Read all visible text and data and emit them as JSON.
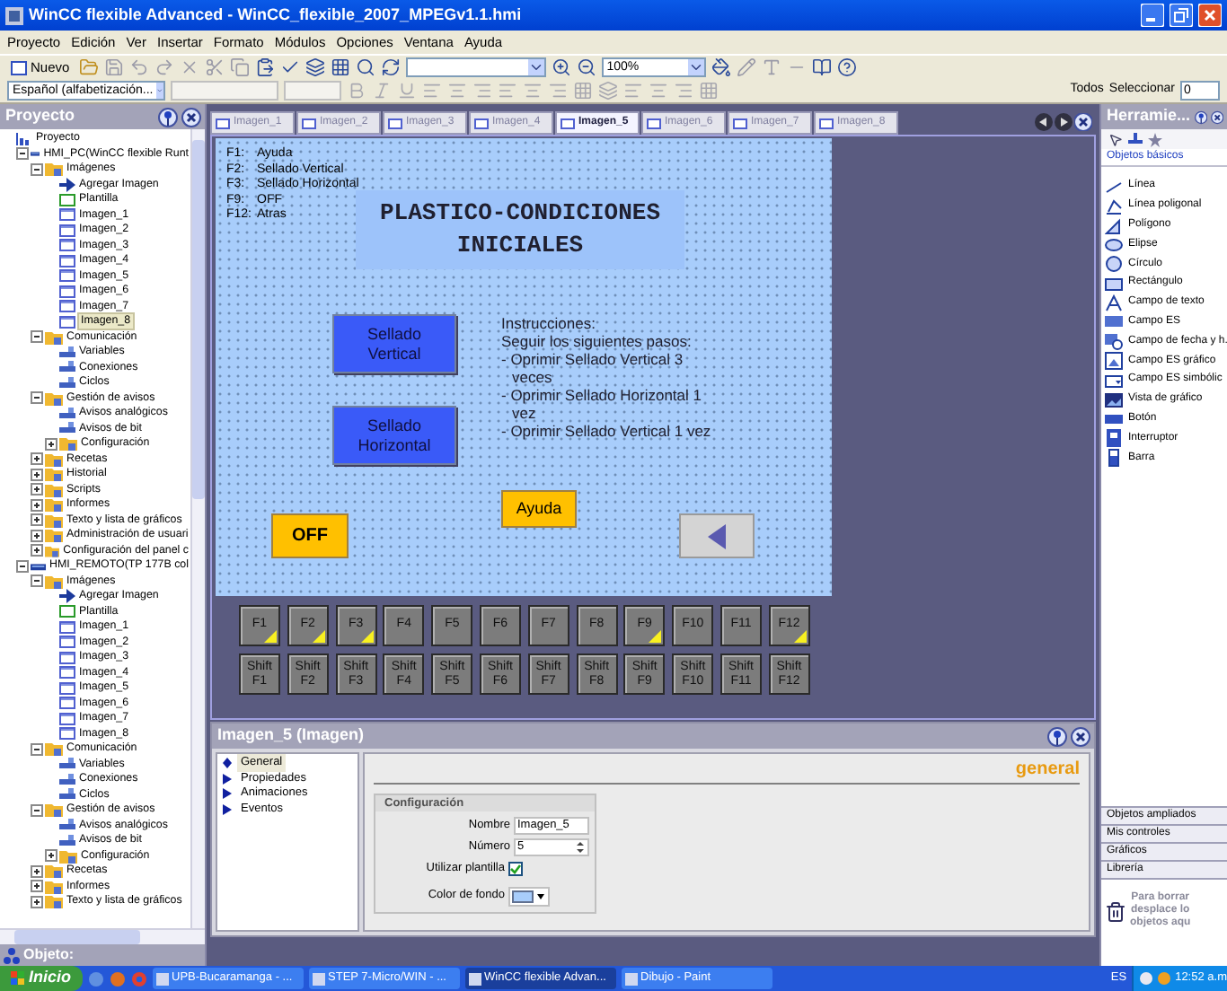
{
  "window": {
    "title": "WinCC flexible Advanced - WinCC_flexible_2007_MPEGv1.1.hmi"
  },
  "menu": [
    "Proyecto",
    "Edición",
    "Ver",
    "Insertar",
    "Formato",
    "Módulos",
    "Opciones",
    "Ventana",
    "Ayuda"
  ],
  "toolbar": {
    "new_button": "Nuevo",
    "zoom": "100%",
    "language": "Español (alfabetización...",
    "all_label": "Todos",
    "select_label": "Seleccionar",
    "spin_value": "0"
  },
  "project_panel": {
    "title": "Proyecto",
    "tree": [
      {
        "label": "Proyecto",
        "kind": "root",
        "selected": false,
        "children": [
          {
            "label": "HMI_PC(WinCC flexible Runt",
            "kind": "device",
            "selected": false,
            "expanded": true,
            "children": [
              {
                "label": "Imágenes",
                "kind": "folder",
                "selected": false,
                "expanded": true,
                "children": [
                  {
                    "label": "Agregar Imagen",
                    "kind": "add",
                    "selected": false
                  },
                  {
                    "label": "Plantilla",
                    "kind": "template",
                    "selected": false
                  },
                  {
                    "label": "Imagen_1",
                    "kind": "screen",
                    "selected": false
                  },
                  {
                    "label": "Imagen_2",
                    "kind": "screen",
                    "selected": false
                  },
                  {
                    "label": "Imagen_3",
                    "kind": "screen",
                    "selected": false
                  },
                  {
                    "label": "Imagen_4",
                    "kind": "screen",
                    "selected": false
                  },
                  {
                    "label": "Imagen_5",
                    "kind": "screen",
                    "selected": false
                  },
                  {
                    "label": "Imagen_6",
                    "kind": "screen",
                    "selected": false
                  },
                  {
                    "label": "Imagen_7",
                    "kind": "screen",
                    "selected": false
                  },
                  {
                    "label": "Imagen_8",
                    "kind": "screen",
                    "selected": true
                  }
                ]
              },
              {
                "label": "Comunicación",
                "kind": "folder",
                "selected": false,
                "expanded": true,
                "children": [
                  {
                    "label": "Variables",
                    "kind": "leaf",
                    "selected": false
                  },
                  {
                    "label": "Conexiones",
                    "kind": "leaf",
                    "selected": false
                  },
                  {
                    "label": "Ciclos",
                    "kind": "leaf",
                    "selected": false
                  }
                ]
              },
              {
                "label": "Gestión de avisos",
                "kind": "folder",
                "selected": false,
                "expanded": true,
                "children": [
                  {
                    "label": "Avisos analógicos",
                    "kind": "leaf",
                    "selected": false
                  },
                  {
                    "label": "Avisos de bit",
                    "kind": "leaf",
                    "selected": false
                  },
                  {
                    "label": "Configuración",
                    "kind": "folder",
                    "selected": false,
                    "expanded": false
                  }
                ]
              },
              {
                "label": "Recetas",
                "kind": "folder",
                "selected": false,
                "expanded": false
              },
              {
                "label": "Historial",
                "kind": "folder",
                "selected": false,
                "expanded": false
              },
              {
                "label": "Scripts",
                "kind": "folder",
                "selected": false,
                "expanded": false
              },
              {
                "label": "Informes",
                "kind": "folder",
                "selected": false,
                "expanded": false
              },
              {
                "label": "Texto y lista de gráficos",
                "kind": "folder",
                "selected": false,
                "expanded": false
              },
              {
                "label": "Administración de usuari",
                "kind": "folder",
                "selected": false,
                "expanded": false
              },
              {
                "label": "Configuración del panel c",
                "kind": "folder",
                "selected": false,
                "expanded": false
              }
            ]
          },
          {
            "label": "HMI_REMOTO(TP 177B col",
            "kind": "device",
            "selected": false,
            "expanded": true,
            "children": [
              {
                "label": "Imágenes",
                "kind": "folder",
                "selected": false,
                "expanded": true,
                "children": [
                  {
                    "label": "Agregar Imagen",
                    "kind": "add",
                    "selected": false
                  },
                  {
                    "label": "Plantilla",
                    "kind": "template",
                    "selected": false
                  },
                  {
                    "label": "Imagen_1",
                    "kind": "screen",
                    "selected": false
                  },
                  {
                    "label": "Imagen_2",
                    "kind": "screen",
                    "selected": false
                  },
                  {
                    "label": "Imagen_3",
                    "kind": "screen",
                    "selected": false
                  },
                  {
                    "label": "Imagen_4",
                    "kind": "screen",
                    "selected": false
                  },
                  {
                    "label": "Imagen_5",
                    "kind": "screen",
                    "selected": false
                  },
                  {
                    "label": "Imagen_6",
                    "kind": "screen",
                    "selected": false
                  },
                  {
                    "label": "Imagen_7",
                    "kind": "screen",
                    "selected": false
                  },
                  {
                    "label": "Imagen_8",
                    "kind": "screen",
                    "selected": false
                  }
                ]
              },
              {
                "label": "Comunicación",
                "kind": "folder",
                "selected": false,
                "expanded": true,
                "children": [
                  {
                    "label": "Variables",
                    "kind": "leaf",
                    "selected": false
                  },
                  {
                    "label": "Conexiones",
                    "kind": "leaf",
                    "selected": false
                  },
                  {
                    "label": "Ciclos",
                    "kind": "leaf",
                    "selected": false
                  }
                ]
              },
              {
                "label": "Gestión de avisos",
                "kind": "folder",
                "selected": false,
                "expanded": true,
                "children": [
                  {
                    "label": "Avisos analógicos",
                    "kind": "leaf",
                    "selected": false
                  },
                  {
                    "label": "Avisos de bit",
                    "kind": "leaf",
                    "selected": false
                  },
                  {
                    "label": "Configuración",
                    "kind": "folder",
                    "selected": false,
                    "expanded": false
                  }
                ]
              },
              {
                "label": "Recetas",
                "kind": "folder",
                "selected": false,
                "expanded": false
              },
              {
                "label": "Informes",
                "kind": "folder",
                "selected": false,
                "expanded": false
              },
              {
                "label": "Texto y lista de gráficos",
                "kind": "folder",
                "selected": false,
                "expanded": false
              }
            ]
          }
        ]
      }
    ]
  },
  "editor": {
    "tabs": [
      {
        "label": "Imagen_1",
        "selected": false
      },
      {
        "label": "Imagen_2",
        "selected": false
      },
      {
        "label": "Imagen_3",
        "selected": false
      },
      {
        "label": "Imagen_4",
        "selected": false
      },
      {
        "label": "Imagen_5",
        "selected": true
      },
      {
        "label": "Imagen_6",
        "selected": false
      },
      {
        "label": "Imagen_7",
        "selected": false
      },
      {
        "label": "Imagen_8",
        "selected": false
      }
    ],
    "screen": {
      "legend": [
        {
          "key": "F1:",
          "label": "Ayuda"
        },
        {
          "key": "F2:",
          "label": "Sellado Vertical"
        },
        {
          "key": "F3:",
          "label": "Sellado Horizontal"
        },
        {
          "key": "F9:",
          "label": "OFF"
        },
        {
          "key": "F12:",
          "label": "Atras"
        }
      ],
      "title": "PLASTICO-CONDICIONES INICIALES",
      "buttons": [
        {
          "kind": "action",
          "label": "Sellado Vertical"
        },
        {
          "kind": "action",
          "label": "Sellado Horizontal"
        },
        {
          "kind": "help",
          "label": "Ayuda"
        },
        {
          "kind": "off",
          "label": "OFF"
        },
        {
          "kind": "back"
        }
      ],
      "instructions": {
        "heading": "Instrucciones:",
        "intro": "Seguir los siguientes pasos:",
        "steps": [
          "- Oprimir Sellado Vertical 3 veces",
          "- Oprimir Sellado Horizontal 1 vez",
          "- Oprimir Sellado Vertical 1 vez"
        ]
      }
    },
    "function_keys": [
      {
        "label": "F1",
        "assigned": true
      },
      {
        "label": "F2",
        "assigned": true
      },
      {
        "label": "F3",
        "assigned": true
      },
      {
        "label": "F4",
        "assigned": false
      },
      {
        "label": "F5",
        "assigned": false
      },
      {
        "label": "F6",
        "assigned": false
      },
      {
        "label": "F7",
        "assigned": false
      },
      {
        "label": "F8",
        "assigned": false
      },
      {
        "label": "F9",
        "assigned": true
      },
      {
        "label": "F10",
        "assigned": false
      },
      {
        "label": "F11",
        "assigned": false
      },
      {
        "label": "F12",
        "assigned": true
      }
    ],
    "shift_keys": [
      "Shift F1",
      "Shift F2",
      "Shift F3",
      "Shift F4",
      "Shift F5",
      "Shift F6",
      "Shift F7",
      "Shift F8",
      "Shift F9",
      "Shift F10",
      "Shift F11",
      "Shift F12"
    ]
  },
  "properties": {
    "title": "Imagen_5 (Imagen)",
    "nav": [
      {
        "label": "General",
        "selected": true
      },
      {
        "label": "Propiedades",
        "selected": false
      },
      {
        "label": "Animaciones",
        "selected": false
      },
      {
        "label": "Eventos",
        "selected": false
      }
    ],
    "heading": "general",
    "group": "Configuración",
    "name_label": "Nombre",
    "name_value": "Imagen_5",
    "number_label": "Número",
    "number_value": "5",
    "template_label": "Utilizar plantilla",
    "template_checked": true,
    "color_label": "Color de fondo"
  },
  "tools": {
    "title": "Herramie...",
    "tab": "Objetos básicos",
    "items": [
      {
        "label": "Línea",
        "kind": "line"
      },
      {
        "label": "Línea poligonal",
        "kind": "polyline"
      },
      {
        "label": "Polígono",
        "kind": "polygon"
      },
      {
        "label": "Elipse",
        "kind": "ellipse"
      },
      {
        "label": "Círculo",
        "kind": "circle"
      },
      {
        "label": "Rectángulo",
        "kind": "rectangle"
      },
      {
        "label": "Campo de texto",
        "kind": "text"
      },
      {
        "label": "Campo ES",
        "kind": "io"
      },
      {
        "label": "Campo de fecha y h.",
        "kind": "datetime"
      },
      {
        "label": "Campo ES gráfico",
        "kind": "graphic-io"
      },
      {
        "label": "Campo ES simbólic",
        "kind": "symbolic-io"
      },
      {
        "label": "Vista de gráfico",
        "kind": "graphic-view"
      },
      {
        "label": "Botón",
        "kind": "button"
      },
      {
        "label": "Interruptor",
        "kind": "switch"
      },
      {
        "label": "Barra",
        "kind": "bar"
      }
    ],
    "categories": [
      "Objetos ampliados",
      "Mis controles",
      "Gráficos",
      "Librería"
    ],
    "trash_lines": [
      "Para borrar",
      "desplace lo",
      "objetos aqu"
    ]
  },
  "status": {
    "object_label": "Objeto:"
  },
  "taskbar": {
    "start": "Inicio",
    "tasks": [
      {
        "label": "UPB-Bucaramanga - ...",
        "selected": false
      },
      {
        "label": "STEP 7-Micro/WIN - ...",
        "selected": false
      },
      {
        "label": "WinCC flexible Advan...",
        "selected": true
      },
      {
        "label": "Dibujo - Paint",
        "selected": false
      }
    ],
    "language": "ES",
    "time": "12:52 a.m"
  }
}
